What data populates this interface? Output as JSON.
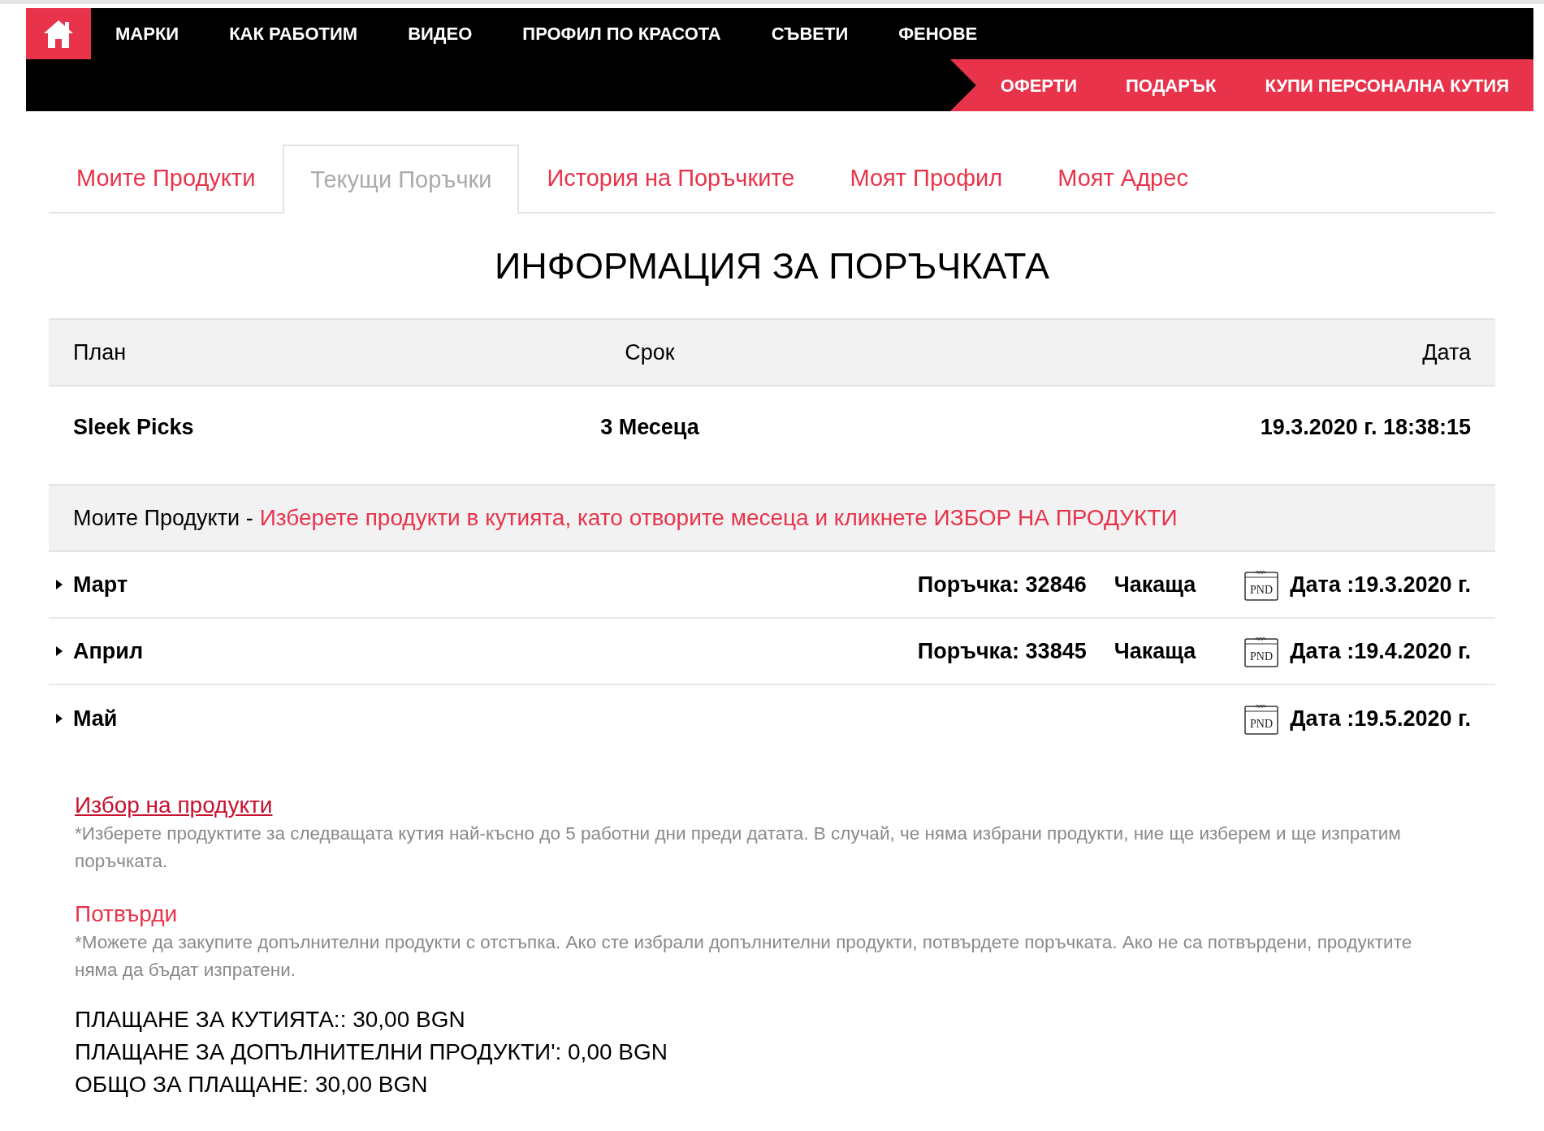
{
  "nav": {
    "main": [
      "МАРКИ",
      "КАК РАБОТИМ",
      "ВИДЕО",
      "ПРОФИЛ ПО КРАСОТА",
      "СЪВЕТИ",
      "ФЕНОВЕ"
    ],
    "secondary": [
      "ОФЕРТИ",
      "ПОДАРЪК",
      "КУПИ ПЕРСОНАЛНА КУТИЯ"
    ]
  },
  "tabs": [
    {
      "label": "Моите Продукти",
      "selected": false
    },
    {
      "label": "Текущи Поръчки",
      "selected": true
    },
    {
      "label": "История на Поръчките",
      "selected": false
    },
    {
      "label": "Моят Профил",
      "selected": false
    },
    {
      "label": "Моят Адрес",
      "selected": false
    }
  ],
  "title": "ИНФОРМАЦИЯ ЗА ПОРЪЧКАТА",
  "order_table": {
    "columns": [
      "План",
      "Срок",
      "Дата"
    ],
    "row": [
      "Sleek Picks",
      "3 Месеца",
      "19.3.2020 г. 18:38:15"
    ]
  },
  "products_section": {
    "label": "Моите Продукти -",
    "hint": "Изберете продукти в кутията, като отворите месеца и кликнете ИЗБОР НА ПРОДУКТИ"
  },
  "months": [
    {
      "name": "Март",
      "expanded": false,
      "order": "Поръчка: 32846",
      "status": "Чакаща",
      "icon_text": "PND",
      "date": "Дата :19.3.2020 г."
    },
    {
      "name": "Април",
      "expanded": false,
      "order": "Поръчка: 33845",
      "status": "Чакаща",
      "icon_text": "PND",
      "date": "Дата :19.4.2020 г."
    },
    {
      "name": "Май",
      "expanded": false,
      "icon_text": "PND",
      "date": "Дата :19.5.2020 г."
    }
  ],
  "notes": [
    {
      "link": "Избор на продукти",
      "underlined": true,
      "text": "*Изберете продуктите за следващата кутия най-късно до 5 работни дни преди датата. В случай, че няма избрани продукти, ние ще изберем и ще изпратим поръчката."
    },
    {
      "link": "Потвърди",
      "underlined": false,
      "text": "*Можете да закупите допълнителни продукти с отстъпка. Ако сте избрали допълнителни продукти, потвърдете поръчката. Ако не са потвърдени, продуктите няма да бъдат изпратени."
    }
  ],
  "totals": [
    "ПЛАЩАНЕ ЗА КУТИЯТА:: 30,00 BGN",
    "ПЛАЩАНЕ ЗА ДОПЪЛНИТЕЛНИ ПРОДУКТИ': 0,00 BGN",
    "ОБЩО ЗА ПЛАЩАНЕ: 30,00 BGN"
  ]
}
